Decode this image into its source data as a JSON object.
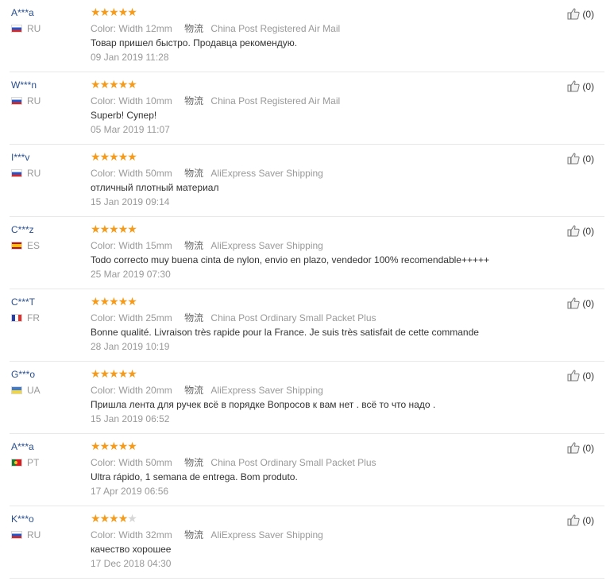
{
  "reviews": [
    {
      "user": "A***a",
      "country": "RU",
      "flag": "ru",
      "stars": 5,
      "color_label": "Color:",
      "color_value": "Width 12mm",
      "logistics_label": "物流",
      "shipping": "China Post Registered Air Mail",
      "text": "Товар пришел быстро. Продавца рекомендую.",
      "date": "09 Jan 2019 11:28",
      "helpful": "(0)"
    },
    {
      "user": "W***n",
      "country": "RU",
      "flag": "ru",
      "stars": 5,
      "color_label": "Color:",
      "color_value": "Width 10mm",
      "logistics_label": "物流",
      "shipping": "China Post Registered Air Mail",
      "text": "Superb! Супер!",
      "date": "05 Mar 2019 11:07",
      "helpful": "(0)"
    },
    {
      "user": "I***v",
      "country": "RU",
      "flag": "ru",
      "stars": 5,
      "color_label": "Color:",
      "color_value": "Width 50mm",
      "logistics_label": "物流",
      "shipping": "AliExpress Saver Shipping",
      "text": "отличный плотный материал",
      "date": "15 Jan 2019 09:14",
      "helpful": "(0)"
    },
    {
      "user": "C***z",
      "country": "ES",
      "flag": "es",
      "stars": 5,
      "color_label": "Color:",
      "color_value": "Width 15mm",
      "logistics_label": "物流",
      "shipping": "AliExpress Saver Shipping",
      "text": "Todo correcto muy buena cinta de nylon, envio en plazo, vendedor 100% recomendable+++++",
      "date": "25 Mar 2019 07:30",
      "helpful": "(0)"
    },
    {
      "user": "C***T",
      "country": "FR",
      "flag": "fr",
      "stars": 5,
      "color_label": "Color:",
      "color_value": "Width 25mm",
      "logistics_label": "物流",
      "shipping": "China Post Ordinary Small Packet Plus",
      "text": "Bonne qualité. Livraison très rapide pour la France. Je suis très satisfait de cette commande",
      "date": "28 Jan 2019 10:19",
      "helpful": "(0)"
    },
    {
      "user": "G***o",
      "country": "UA",
      "flag": "ua",
      "stars": 5,
      "color_label": "Color:",
      "color_value": "Width 20mm",
      "logistics_label": "物流",
      "shipping": "AliExpress Saver Shipping",
      "text": "Пришла лента для ручек всё в порядке Вопросов к вам нет . всё то что надо .",
      "date": "15 Jan 2019 06:52",
      "helpful": "(0)"
    },
    {
      "user": "A***a",
      "country": "PT",
      "flag": "pt",
      "stars": 5,
      "color_label": "Color:",
      "color_value": "Width 50mm",
      "logistics_label": "物流",
      "shipping": "China Post Ordinary Small Packet Plus",
      "text": "Ultra rápido, 1 semana de entrega. Bom produto.",
      "date": "17 Apr 2019 06:56",
      "helpful": "(0)"
    },
    {
      "user": "K***o",
      "country": "RU",
      "flag": "ru",
      "stars": 4,
      "color_label": "Color:",
      "color_value": "Width 32mm",
      "logistics_label": "物流",
      "shipping": "AliExpress Saver Shipping",
      "text": "качество хорошее",
      "date": "17 Dec 2018 04:30",
      "helpful": "(0)"
    }
  ],
  "colors": {
    "star": "#f59b1c",
    "star_empty": "#d6d6d6",
    "username": "#2a4f8f",
    "muted": "#999999"
  },
  "icons": {
    "helpful": "thumbs-up-icon",
    "rating": "star-icon"
  }
}
